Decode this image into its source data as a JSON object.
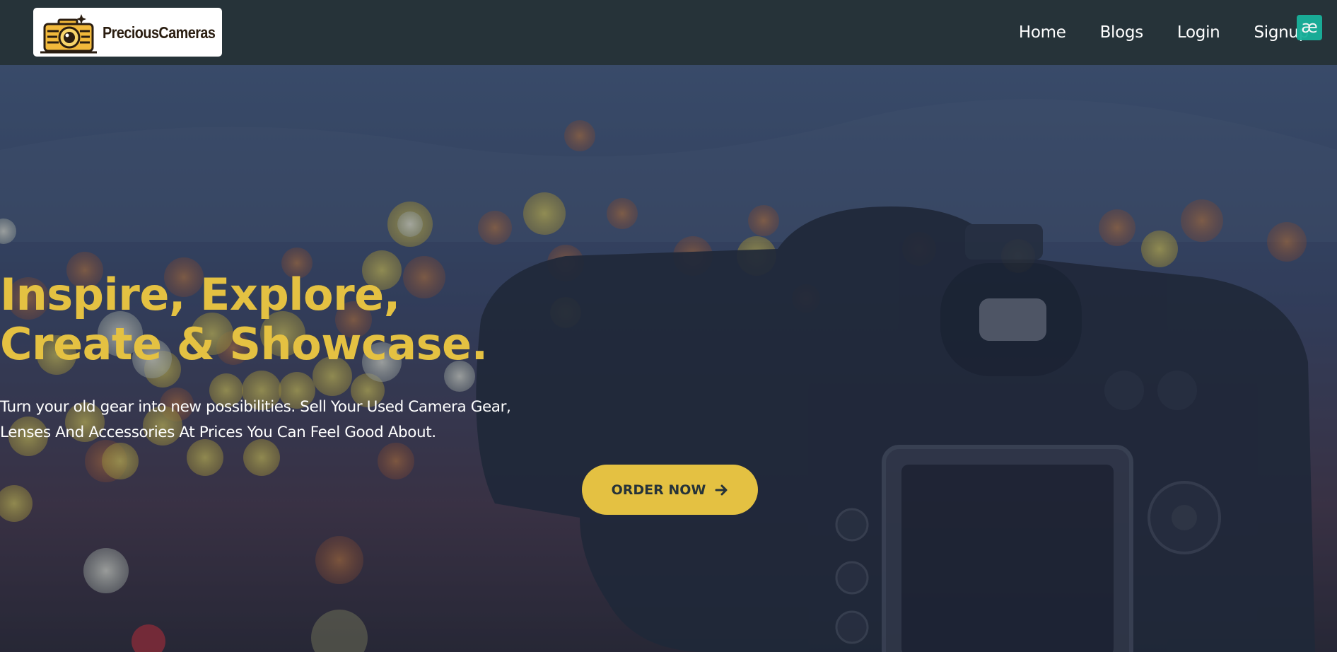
{
  "brand": {
    "name": "PreciousCameras",
    "logo_icon": "camera-icon"
  },
  "nav": {
    "items": [
      {
        "label": "Home"
      },
      {
        "label": "Blogs"
      },
      {
        "label": "Login"
      },
      {
        "label": "Signup"
      }
    ]
  },
  "extension_badge": {
    "label": "æ"
  },
  "hero": {
    "title_line1": "Inspire, Explore,",
    "title_line2": "Create & Showcase.",
    "subtitle_line1": "Turn your old gear into new possibilities. Sell Your Used Camera Gear,",
    "subtitle_line2": "Lenses And Accessories At Prices You Can Feel Good About.",
    "cta_label": "ORDER NOW",
    "cta_icon": "arrow-right-icon",
    "background": "bokeh-city-lights-with-nikon-camera-photo"
  },
  "colors": {
    "nav_bg": "#263339",
    "accent": "#e4c142",
    "text_light": "#ffffff",
    "badge": "#19b29b"
  }
}
